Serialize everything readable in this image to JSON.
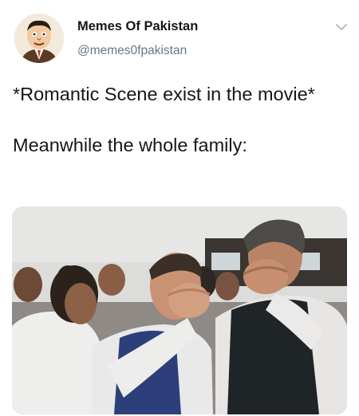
{
  "author": {
    "display_name": "Memes Of Pakistan",
    "handle": "@memes0fpakistan",
    "avatar_icon": "cartoon-man-avatar-icon"
  },
  "menu": {
    "icon": "chevron-down-icon"
  },
  "tweet": {
    "text": "*Romantic Scene exist in the movie*\n\nMeanwhile the whole family:"
  },
  "media": {
    "type": "photo",
    "icon": "photo-men-covering-faces"
  },
  "colors": {
    "text": "#14171a",
    "secondary": "#657786",
    "chevron": "#aab8c2"
  }
}
